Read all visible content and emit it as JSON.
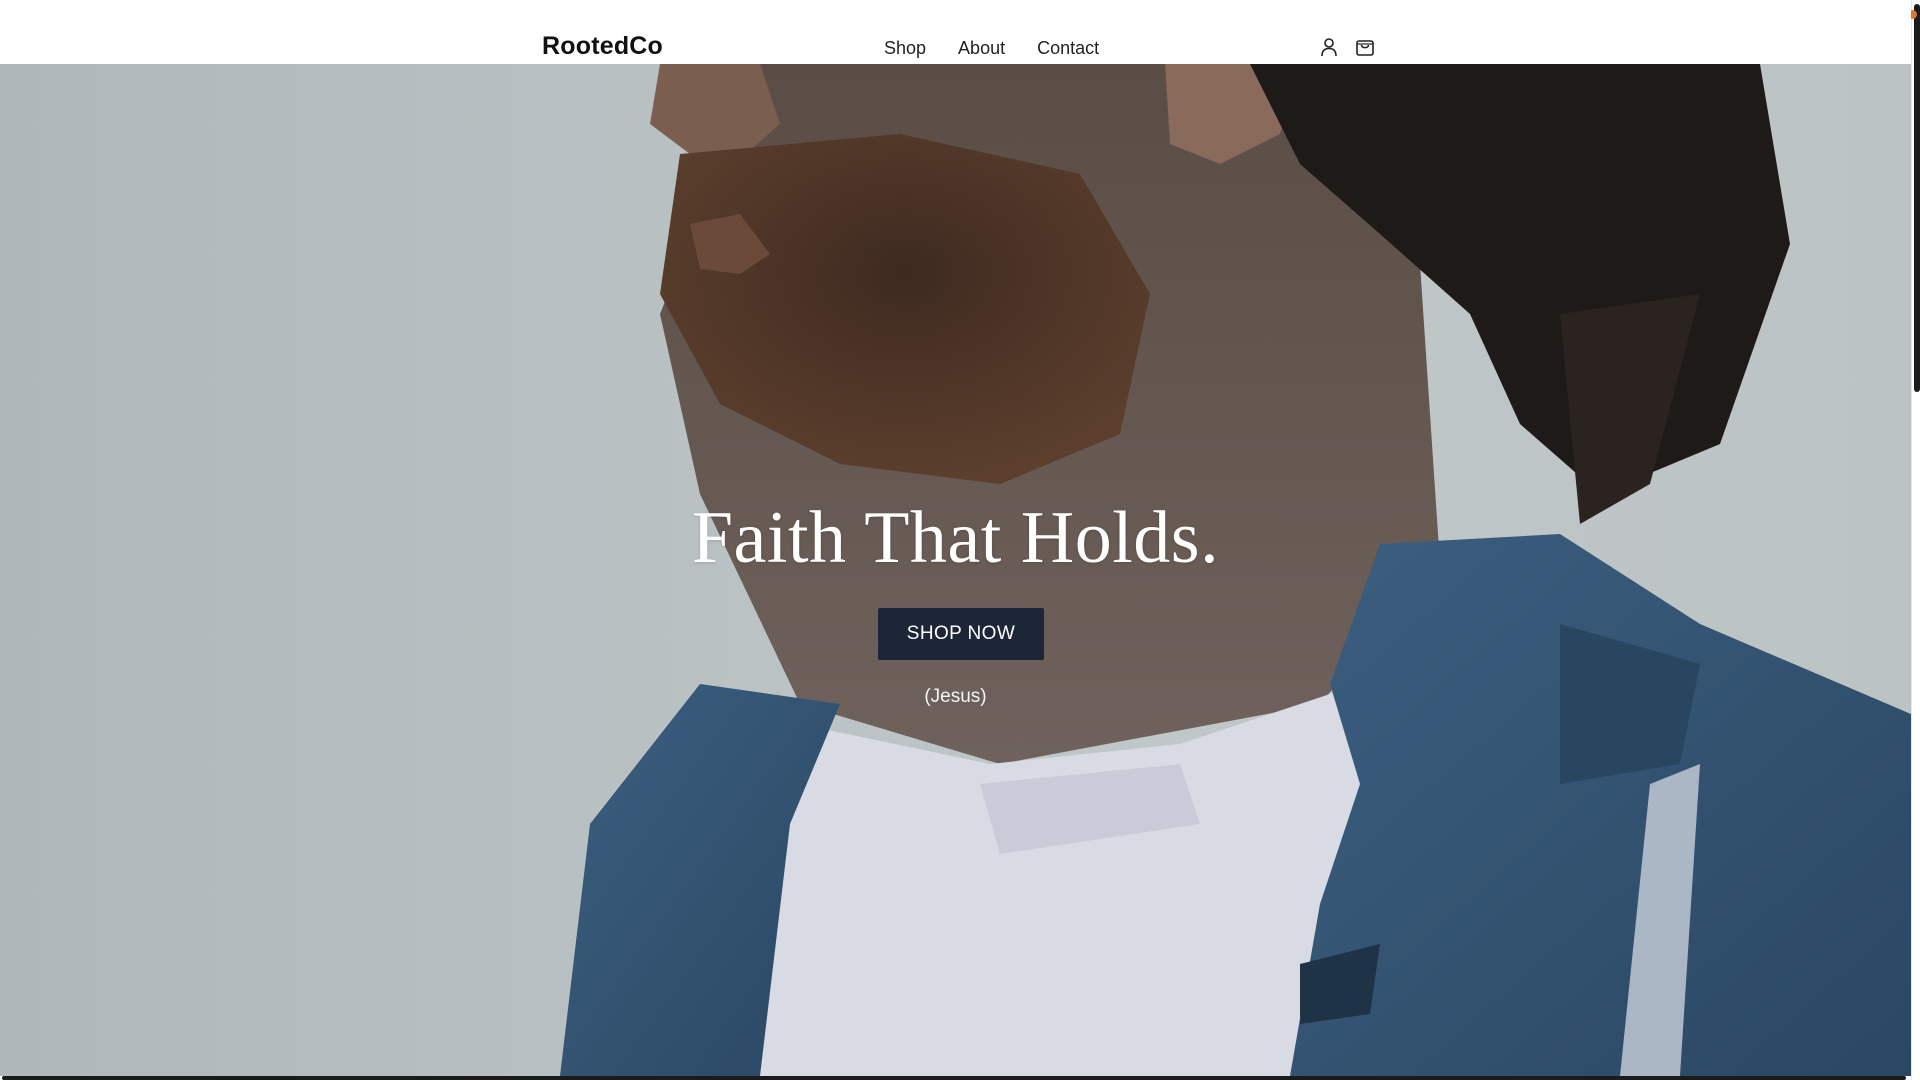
{
  "header": {
    "brand": "RootedCo",
    "nav": [
      {
        "label": "Shop"
      },
      {
        "label": "About"
      },
      {
        "label": "Contact"
      }
    ],
    "icons": [
      "user-icon",
      "cart-icon"
    ]
  },
  "hero": {
    "title": "Faith That Holds.",
    "cta_label": "SHOP NOW",
    "caption": "(Jesus)",
    "image": "man-in-denim-jacket-photo"
  },
  "colors": {
    "cta_background": "#1d2637",
    "header_background": "#ffffff",
    "brand_text": "#111111"
  }
}
